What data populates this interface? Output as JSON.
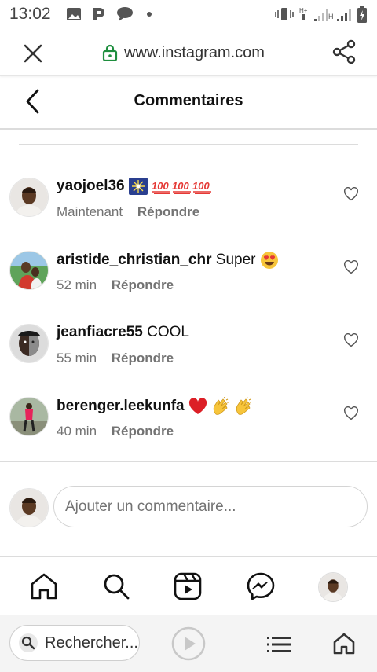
{
  "status_bar": {
    "time": "13:02"
  },
  "browser": {
    "url": "www.instagram.com"
  },
  "header": {
    "title": "Commentaires"
  },
  "comments": [
    {
      "username": "yaojoel36",
      "text": "",
      "emojis": [
        "fireworks",
        "100",
        "100",
        "100"
      ],
      "time": "Maintenant",
      "reply": "Répondre"
    },
    {
      "username": "aristide_christian_chr",
      "text": "Super",
      "emojis": [
        "heart-eyes"
      ],
      "time": "52 min",
      "reply": "Répondre"
    },
    {
      "username": "jeanfiacre55",
      "text": "COOL",
      "emojis": [],
      "time": "55 min",
      "reply": "Répondre"
    },
    {
      "username": "berenger.leekunfa",
      "text": "",
      "emojis": [
        "red-heart",
        "clap",
        "clap"
      ],
      "time": "40 min",
      "reply": "Répondre"
    }
  ],
  "add_comment": {
    "placeholder": "Ajouter un commentaire..."
  },
  "bottom_nav": {
    "items": [
      "home-icon",
      "search-icon",
      "reels-icon",
      "messenger-icon",
      "profile-avatar"
    ]
  },
  "browser_bottom": {
    "search_label": "Rechercher..."
  },
  "colors": {
    "lock_green": "#1e8e3e",
    "heart_red": "#e0245e",
    "muted": "#737373"
  }
}
